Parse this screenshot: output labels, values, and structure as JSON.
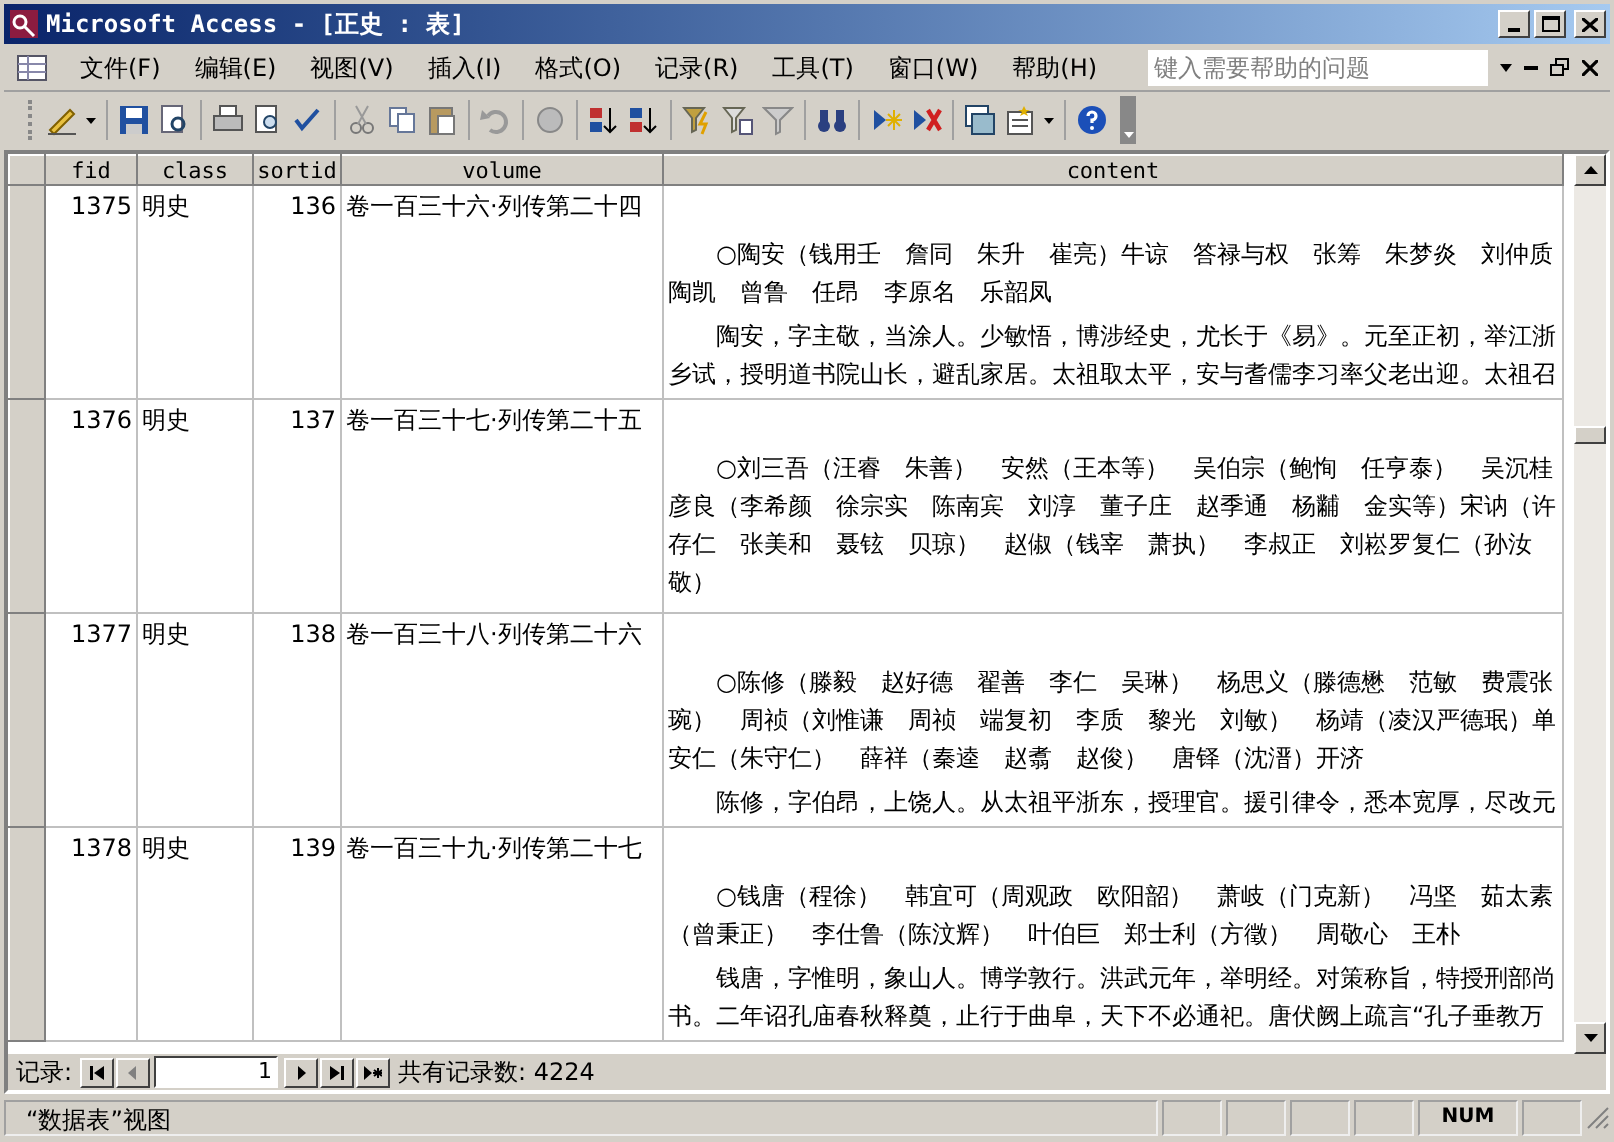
{
  "window": {
    "title": "Microsoft Access - [正史 : 表]"
  },
  "menu": [
    "文件(F)",
    "编辑(E)",
    "视图(V)",
    "插入(I)",
    "格式(O)",
    "记录(R)",
    "工具(T)",
    "窗口(W)",
    "帮助(H)"
  ],
  "help_box": {
    "placeholder": "键入需要帮助的问题"
  },
  "table": {
    "columns": [
      "fid",
      "class",
      "sortid",
      "volume",
      "content"
    ],
    "rows": [
      {
        "fid": "1375",
        "class": "明史",
        "sortid": "136",
        "volume": "卷一百三十六·列传第二十四",
        "content": [
          "　　○陶安（钱用壬　詹同　朱升　崔亮）牛谅　答禄与权　张筹　朱梦炎　刘仲质陶凯　曾鲁　任昂　李原名　乐韶凤",
          "　　陶安，字主敬，当涂人。少敏悟，博涉经史，尤长于《易》。元至正初，举江浙乡试，授明道书院山长，避乱家居。太祖取太平，安与耆儒李习率父老出迎。太祖召"
        ]
      },
      {
        "fid": "1376",
        "class": "明史",
        "sortid": "137",
        "volume": "卷一百三十七·列传第二十五",
        "content": [
          "　　○刘三吾（汪睿　朱善）　安然（王本等）　吴伯宗（鲍恂　任亨泰）　吴沉桂彦良（李希颜　徐宗实　陈南宾　刘淳　董子庄　赵季通　杨黼　金实等）宋讷（许存仁　张美和　聂铉　贝琼）　赵俶（钱宰　萧执）　李叔正　刘崧罗复仁（孙汝敬）"
        ]
      },
      {
        "fid": "1377",
        "class": "明史",
        "sortid": "138",
        "volume": "卷一百三十八·列传第二十六",
        "content": [
          "　　○陈修（滕毅　赵好德　翟善　李仁　吴琳）　杨思义（滕德懋　范敏　费震张琬）　周祯（刘惟谦　周祯　端复初　李质　黎光　刘敏）　杨靖（凌汉严德珉）单安仁（朱守仁）　薛祥（秦逵　赵翥　赵俊）　唐铎（沈溍）开济",
          "　　陈修，字伯昂，上饶人。从太祖平浙东，授理官。援引律令，悉本宽厚，尽改元"
        ]
      },
      {
        "fid": "1378",
        "class": "明史",
        "sortid": "139",
        "volume": "卷一百三十九·列传第二十七",
        "content": [
          "　　○钱唐（程徐）　韩宜可（周观政　欧阳韶）　萧岐（门克新）　冯坚　茹太素（曾秉正）　李仕鲁（陈汶辉）　叶伯巨　郑士利（方徵）　周敬心　王朴",
          "　　钱唐，字惟明，象山人。博学敦行。洪武元年，举明经。对策称旨，特授刑部尚书。二年诏孔庙春秋释奠，止行于曲阜，天下不必通祀。唐伏阙上疏言“孔子垂教万"
        ]
      }
    ]
  },
  "navigation": {
    "label": "记录:",
    "current": "1",
    "total": "共有记录数: 4224"
  },
  "status_bar": {
    "view": "“数据表”视图",
    "num_lock": "NUM"
  }
}
